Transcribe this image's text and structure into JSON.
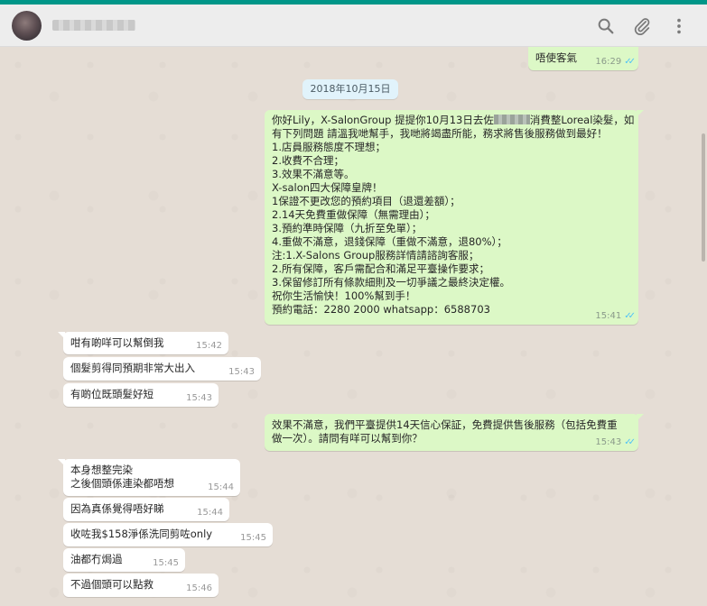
{
  "header": {
    "contact_name": "████████"
  },
  "icons": {
    "search": "search-icon",
    "attach": "paperclip-icon",
    "menu": "more-vertical-icon"
  },
  "colors": {
    "accent": "#009688",
    "outgoing_bubble": "#dcf8c6",
    "incoming_bubble": "#ffffff",
    "chat_background": "#e5ddd5",
    "read_ticks": "#4fc3f7",
    "date_pill": "#e1f3fb"
  },
  "date_separator": "2018年10月15日",
  "messages": {
    "m0": {
      "text": "唔使客氣",
      "time": "16:29"
    },
    "m1": {
      "lines": [
        "你好Lily，X-SalonGroup 提提你10月13日去佐",
        "消費整Loreal染髮，如",
        "有下列問題 請溫我哋幫手，我哋將竭盡所能，務求將售後服務做到最好！",
        "1.店員服務態度不理想；",
        "2.收費不合理；",
        "3.效果不滿意等。",
        "X-salon四大保障皇牌！",
        "1保證不更改您的預約項目（退還差額）；",
        "2.14天免費重做保障（無需理由）；",
        "3.預約準時保障（九折至免單）；",
        "4.重做不滿意，退錢保障（重做不滿意，退80%）；",
        "注:1.X-Salons Group服務詳情請諮詢客服；",
        "2.所有保障，客戶需配合和滿足平臺操作要求；",
        "3.保留修訂所有條款細則及一切爭議之最終決定權。",
        "祝你生活愉快！100%幫到手！",
        "預約電話：2280 2000    whatsapp：6588703"
      ],
      "time": "15:41"
    },
    "m2": {
      "text": "咁有啲咩可以幫倒我",
      "time": "15:42"
    },
    "m3": {
      "text": "個髮剪得同預期非常大出入",
      "time": "15:43"
    },
    "m4": {
      "text": "有啲位既頭髮好短",
      "time": "15:43"
    },
    "m5": {
      "lines": [
        "效果不滿意，我們平臺提供14天信心保証，免費提供售後服務（包括免費重",
        "做一次）。請問有咩可以幫到你？"
      ],
      "time": "15:43"
    },
    "m6": {
      "lines": [
        "本身想整完染",
        "之後個頭係連染都唔想"
      ],
      "time": "15:44"
    },
    "m7": {
      "text": "因為真係覺得唔好睇",
      "time": "15:44"
    },
    "m8": {
      "text": "收咗我$158淨係洗同剪咗only",
      "time": "15:45"
    },
    "m9": {
      "text": "油都冇焗過",
      "time": "15:45"
    },
    "m10": {
      "text": "不過個頭可以點救",
      "time": "15:46"
    }
  }
}
